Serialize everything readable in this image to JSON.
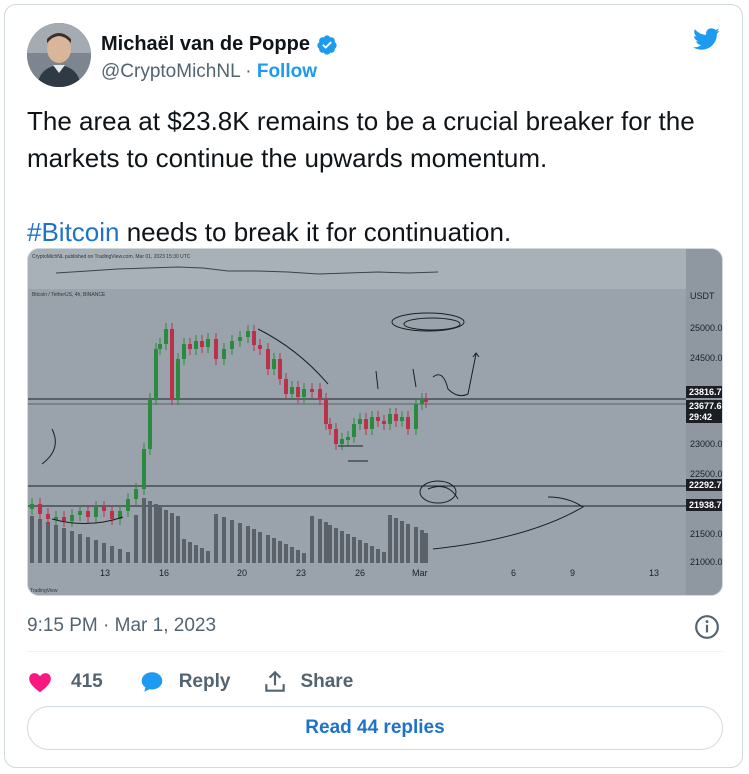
{
  "author": {
    "name": "Michaël van de Poppe",
    "handle": "@CryptoMichNL",
    "separator": "·",
    "follow_label": "Follow"
  },
  "tweet": {
    "line1": "The area at $23.8K remains to be a crucial breaker for the markets to continue the upwards momentum.",
    "hashtag": "#Bitcoin",
    "line2_rest": " needs to break it for continuation."
  },
  "chart": {
    "header_text": "CryptoMichNL published on TradingView.com, Mar 01, 2023 15:30 UTC",
    "symbol_text": "Bitcoin / TetherUS, 4h, BINANCE",
    "currency": "USDT",
    "price_labels": [
      "25000.0",
      "24500.0",
      "23000.0",
      "22500.0",
      "21500.0",
      "21000.0"
    ],
    "price_tags": [
      "23816.7",
      "23677.6",
      "29:42",
      "22292.7",
      "21938.7"
    ],
    "date_labels": [
      "13",
      "16",
      "20",
      "23",
      "26",
      "Mar",
      "6",
      "9",
      "13"
    ],
    "watermark": "TradingView",
    "colors": {
      "up": "#2a8a3e",
      "down": "#b8324a",
      "bg": "#9aa3ac"
    }
  },
  "timestamp": {
    "time": "9:15 PM",
    "separator": "·",
    "date": "Mar 1, 2023"
  },
  "actions": {
    "likes": "415",
    "reply_label": "Reply",
    "share_label": "Share"
  },
  "read_replies_label": "Read 44 replies",
  "colors": {
    "accent": "#1d9bf0",
    "like": "#f91880",
    "text": "#0f1419",
    "muted": "#536471"
  }
}
